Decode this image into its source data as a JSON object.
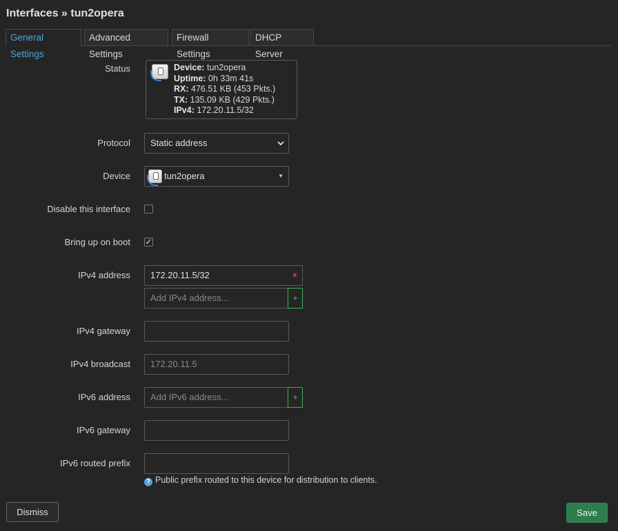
{
  "page": {
    "title": "Interfaces » tun2opera"
  },
  "tabs": [
    {
      "label": "General Settings",
      "active": true
    },
    {
      "label": "Advanced Settings",
      "active": false
    },
    {
      "label": "Firewall Settings",
      "active": false
    },
    {
      "label": "DHCP Server",
      "active": false
    }
  ],
  "status": {
    "label": "Status",
    "device_key": "Device:",
    "device_val": "tun2opera",
    "uptime_key": "Uptime:",
    "uptime_val": "0h 33m 41s",
    "rx_key": "RX:",
    "rx_val": "476.51 KB (453 Pkts.)",
    "tx_key": "TX:",
    "tx_val": "135.09 KB (429 Pkts.)",
    "ipv4_key": "IPv4:",
    "ipv4_val": "172.20.11.5/32"
  },
  "protocol": {
    "label": "Protocol",
    "value": "Static address"
  },
  "device": {
    "label": "Device",
    "value": "tun2opera"
  },
  "disable_interface": {
    "label": "Disable this interface",
    "checked": false
  },
  "bring_up_on_boot": {
    "label": "Bring up on boot",
    "checked": true,
    "check_glyph": "✓"
  },
  "ipv4_address": {
    "label": "IPv4 address",
    "value": "172.20.11.5/32",
    "placeholder": "Add IPv4 address...",
    "remove_glyph": "×",
    "add_glyph": "+"
  },
  "ipv4_gateway": {
    "label": "IPv4 gateway",
    "value": ""
  },
  "ipv4_broadcast": {
    "label": "IPv4 broadcast",
    "placeholder": "172.20.11.5"
  },
  "ipv6_address": {
    "label": "IPv6 address",
    "placeholder": "Add IPv6 address...",
    "add_glyph": "+"
  },
  "ipv6_gateway": {
    "label": "IPv6 gateway",
    "value": ""
  },
  "ipv6_routed_prefix": {
    "label": "IPv6 routed prefix",
    "value": "",
    "help_glyph": "?",
    "hint": "Public prefix routed to this device for distribution to clients."
  },
  "actions": {
    "dismiss_label": "Dismiss",
    "save_label": "Save"
  },
  "colors": {
    "accent": "#4ea6d8",
    "save": "#2f7d4c",
    "add": "#3fae5a",
    "remove": "#d9534f"
  },
  "icons": {
    "device": "ethernet-port-icon",
    "select": "chevron-down-icon",
    "dropdown": "caret-down-icon",
    "help": "question-circle-icon"
  }
}
